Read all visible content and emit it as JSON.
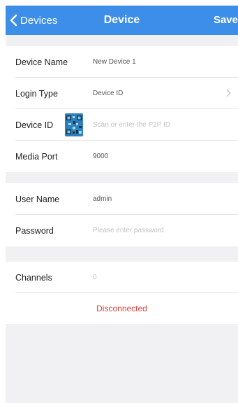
{
  "nav": {
    "back_label": "Devices",
    "title": "Device",
    "save_label": "Save",
    "bar_color": "#3c8ee8"
  },
  "device_group": {
    "name": {
      "label": "Device Name",
      "value": "New Device 1"
    },
    "login_type": {
      "label": "Login Type",
      "value": "Device ID"
    },
    "device_id": {
      "label": "Device ID",
      "placeholder": "Scan or enter the P2P ID",
      "qr_icon": "qr-code-scan-icon"
    },
    "media_port": {
      "label": "Media Port",
      "value": "9000"
    }
  },
  "auth_group": {
    "user_name": {
      "label": "User Name",
      "value": "admin"
    },
    "password": {
      "label": "Password",
      "placeholder": "Please enter password"
    }
  },
  "channels_group": {
    "channels": {
      "label": "Channels",
      "value": "0"
    },
    "status": "Disconnected",
    "status_color": "#d8443c"
  }
}
